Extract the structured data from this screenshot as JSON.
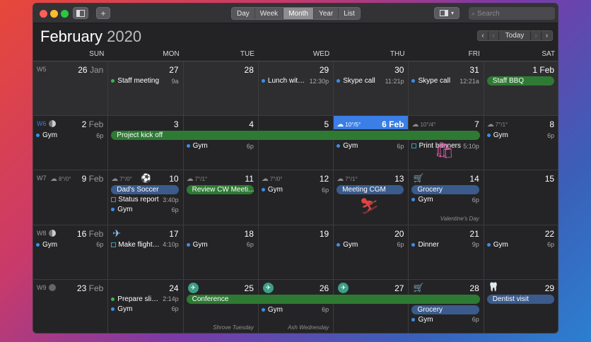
{
  "toolbar": {
    "views": [
      "Day",
      "Week",
      "Month",
      "Year",
      "List"
    ],
    "active_view": "Month",
    "search_placeholder": "Search",
    "add_label": "+"
  },
  "header": {
    "month": "February",
    "year": "2020"
  },
  "nav": {
    "prev": "‹",
    "today": "Today",
    "next": "›"
  },
  "weekdays": [
    "SUN",
    "MON",
    "TUE",
    "WED",
    "THU",
    "FRI",
    "SAT"
  ],
  "weeks": [
    {
      "label": "W5",
      "days": [
        {
          "n": "26",
          "mo": "Jan",
          "past": true,
          "events": []
        },
        {
          "n": "27",
          "past": true,
          "events": [
            {
              "type": "dot",
              "color": "#3fb34f",
              "name": "Staff meeting",
              "time": "9a"
            }
          ]
        },
        {
          "n": "28",
          "past": true,
          "events": []
        },
        {
          "n": "29",
          "past": true,
          "events": [
            {
              "type": "dot",
              "color": "#3b8ee8",
              "name": "Lunch with...",
              "time": "12:30p"
            }
          ]
        },
        {
          "n": "30",
          "past": true,
          "events": [
            {
              "type": "dot",
              "color": "#3b8ee8",
              "name": "Skype call",
              "time": "11:21p"
            }
          ]
        },
        {
          "n": "31",
          "past": true,
          "events": [
            {
              "type": "dot",
              "color": "#3b8ee8",
              "name": "Skype call",
              "time": "12:21a"
            }
          ]
        },
        {
          "n": "1 Feb",
          "past": true,
          "events": [
            {
              "type": "bar",
              "color": "green",
              "name": "Staff BBQ"
            }
          ]
        }
      ]
    },
    {
      "label": "W6",
      "days": [
        {
          "n": "2",
          "mo": "Feb",
          "events": [
            {
              "type": "dot",
              "color": "#3b8ee8",
              "name": "Gym",
              "time": "6p"
            }
          ]
        },
        {
          "n": "3",
          "events": []
        },
        {
          "n": "4",
          "events": [
            {
              "type": "dot",
              "color": "#3b8ee8",
              "name": "Gym",
              "time": "6p"
            }
          ]
        },
        {
          "n": "5",
          "events": []
        },
        {
          "n": "6 Feb",
          "weather": "10°/5°",
          "today": true,
          "events": [
            {
              "type": "dot",
              "color": "#3b8ee8",
              "name": "Gym",
              "time": "6p"
            }
          ]
        },
        {
          "n": "7",
          "weather": "10°/4°",
          "events": [
            {
              "type": "box",
              "name": "Print banners",
              "time": "5:10p"
            }
          ]
        },
        {
          "n": "8",
          "weather": "7°/1°",
          "events": [
            {
              "type": "dot",
              "color": "#3b8ee8",
              "name": "Gym",
              "time": "6p"
            }
          ]
        }
      ]
    },
    {
      "label": "W7",
      "days": [
        {
          "n": "9",
          "mo": "Feb",
          "weather": "8°/0°",
          "events": []
        },
        {
          "n": "10",
          "weather": "7°/0°",
          "events": [
            {
              "type": "bar",
              "color": "blue",
              "name": "Dad's Soccer"
            },
            {
              "type": "box",
              "name": "Status report",
              "time": "3:40p"
            },
            {
              "type": "dot",
              "color": "#3b8ee8",
              "name": "Gym",
              "time": "6p"
            }
          ]
        },
        {
          "n": "11",
          "weather": "7°/1°",
          "events": [
            {
              "type": "bar",
              "color": "green",
              "name": "Review CW Meeti..."
            }
          ]
        },
        {
          "n": "12",
          "weather": "7°/0°",
          "events": [
            {
              "type": "dot",
              "color": "#3b8ee8",
              "name": "Gym",
              "time": "6p"
            }
          ]
        },
        {
          "n": "13",
          "weather": "7°/1°",
          "events": [
            {
              "type": "bar",
              "color": "blue",
              "name": "Meeting CGM"
            }
          ]
        },
        {
          "n": "14",
          "events": [
            {
              "type": "bar",
              "color": "blue",
              "name": "Grocery"
            },
            {
              "type": "dot",
              "color": "#3b8ee8",
              "name": "Gym",
              "time": "6p"
            }
          ],
          "footer": "Valentine's Day"
        },
        {
          "n": "15",
          "events": []
        }
      ]
    },
    {
      "label": "W8",
      "days": [
        {
          "n": "16",
          "mo": "Feb",
          "events": [
            {
              "type": "dot",
              "color": "#3b8ee8",
              "name": "Gym",
              "time": "6p"
            }
          ]
        },
        {
          "n": "17",
          "events": [
            {
              "type": "box",
              "name": "Make flight re...",
              "time": "4:10p"
            }
          ]
        },
        {
          "n": "18",
          "events": [
            {
              "type": "dot",
              "color": "#3b8ee8",
              "name": "Gym",
              "time": "6p"
            }
          ]
        },
        {
          "n": "19",
          "events": []
        },
        {
          "n": "20",
          "events": [
            {
              "type": "dot",
              "color": "#3b8ee8",
              "name": "Gym",
              "time": "6p"
            }
          ]
        },
        {
          "n": "21",
          "events": [
            {
              "type": "dot",
              "color": "#3b8ee8",
              "name": "Dinner",
              "time": "9p"
            }
          ]
        },
        {
          "n": "22",
          "events": [
            {
              "type": "dot",
              "color": "#3b8ee8",
              "name": "Gym",
              "time": "6p"
            }
          ]
        }
      ]
    },
    {
      "label": "W9",
      "days": [
        {
          "n": "23",
          "mo": "Feb",
          "events": []
        },
        {
          "n": "24",
          "events": [
            {
              "type": "dot",
              "color": "#3fb34f",
              "name": "Prepare slides",
              "time": "2:14p"
            },
            {
              "type": "dot",
              "color": "#3b8ee8",
              "name": "Gym",
              "time": "6p"
            }
          ]
        },
        {
          "n": "25",
          "events": [],
          "footer": "Shrove Tuesday"
        },
        {
          "n": "26",
          "events": [
            {
              "type": "dot",
              "color": "#3b8ee8",
              "name": "Gym",
              "time": "6p"
            }
          ],
          "footer": "Ash Wednesday"
        },
        {
          "n": "27",
          "events": []
        },
        {
          "n": "28",
          "events": [
            {
              "type": "bar",
              "color": "blue",
              "name": "Grocery"
            },
            {
              "type": "dot",
              "color": "#3b8ee8",
              "name": "Gym",
              "time": "6p"
            }
          ]
        },
        {
          "n": "29",
          "events": [
            {
              "type": "bar",
              "color": "blue",
              "name": "Dentist visit"
            }
          ]
        }
      ]
    }
  ],
  "multiday": [
    {
      "name": "Project kick off",
      "color": "green",
      "week": 1,
      "start": 1,
      "end": 5
    },
    {
      "name": "Conference",
      "color": "green",
      "week": 4,
      "start": 2,
      "end": 5
    }
  ],
  "colors": {
    "today": "#3a7ee6",
    "green_bar": "#2e7a34",
    "blue_bar": "#3b5b8c"
  }
}
